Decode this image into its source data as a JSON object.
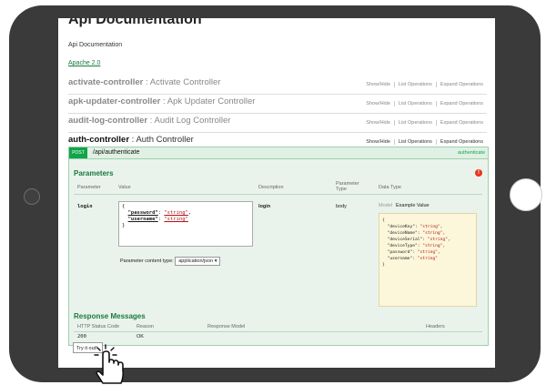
{
  "header": {
    "title": "Api Documentation",
    "subtitle": "Api Documentation",
    "license_link": "Apache 2.0"
  },
  "controllers": [
    {
      "name": "activate-controller",
      "desc": "Activate Controller"
    },
    {
      "name": "apk-updater-controller",
      "desc": "Apk Updater Controller"
    },
    {
      "name": "audit-log-controller",
      "desc": "Audit Log Controller"
    },
    {
      "name": "auth-controller",
      "desc": "Auth Controller"
    }
  ],
  "controller_ops": {
    "show_hide": "Show/Hide",
    "list": "List Operations",
    "expand": "Expand Operations"
  },
  "endpoint": {
    "method": "POST",
    "path": "/api/authenticate",
    "right_label": "authenticate"
  },
  "parameters": {
    "title": "Parameters",
    "columns": {
      "parameter": "Parameter",
      "value": "Value",
      "description": "Description",
      "parameter_type_1": "Parameter",
      "parameter_type_2": "Type",
      "data_type": "Data Type"
    },
    "row": {
      "name": "login",
      "description": "login",
      "type": "body"
    },
    "body": {
      "open": "{",
      "password_key": "\"password\"",
      "password_val": "\"string\"",
      "username_key": "\"username\"",
      "username_val": "\"string\"",
      "close": "}"
    },
    "content_type_label": "Parameter content type:",
    "content_type_value": "application/json"
  },
  "model": {
    "tab_model": "Model",
    "tab_example": "Example Value",
    "example_lines": [
      {
        "key": "\"deviceKey\"",
        "val": "\"string\""
      },
      {
        "key": "\"deviceName\"",
        "val": "\"string\""
      },
      {
        "key": "\"deviceSerial\"",
        "val": "\"string\""
      },
      {
        "key": "\"deviceType\"",
        "val": "\"string\""
      },
      {
        "key": "\"password\"",
        "val": "\"string\""
      },
      {
        "key": "\"username\"",
        "val": "\"string\""
      }
    ]
  },
  "responses": {
    "title": "Response Messages",
    "columns": {
      "code": "HTTP Status Code",
      "reason": "Reason",
      "model": "Response Model",
      "headers": "Headers"
    },
    "rows": [
      {
        "code": "200",
        "reason": "OK"
      }
    ]
  },
  "try_button": "Try it out!"
}
